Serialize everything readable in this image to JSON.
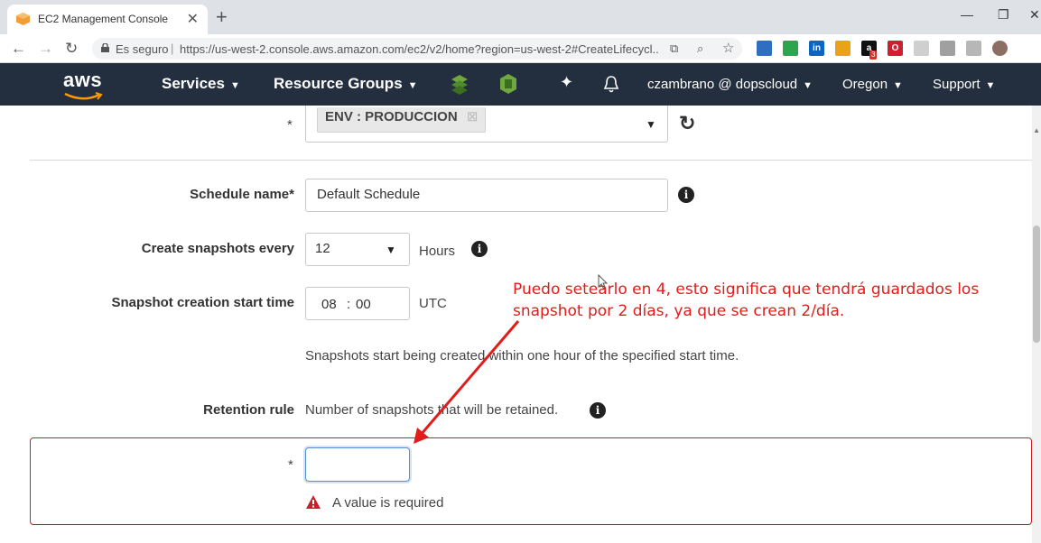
{
  "browser": {
    "tab_title": "EC2 Management Console",
    "tab_close": "✕",
    "new_tab": "+",
    "window_controls": [
      "—",
      "❐",
      "✕"
    ],
    "secure_label": "Es seguro",
    "separator": "|",
    "url": "https://us-west-2.console.aws.amazon.com/ec2/v2/home?region=us-west-2#CreateLifecycl...",
    "extensions": [
      {
        "icon": "ext-blue-square-icon",
        "color": "#2e6fc0",
        "text": ""
      },
      {
        "icon": "ext-green-download-icon",
        "color": "#2ea44f",
        "text": ""
      },
      {
        "icon": "linkedin-icon",
        "color": "#0a66c2",
        "text": "in"
      },
      {
        "icon": "ext-orange-warning-icon",
        "color": "#e8a317",
        "text": ""
      },
      {
        "icon": "ext-amazon-icon",
        "color": "#111111",
        "text": "a"
      },
      {
        "icon": "opera-icon",
        "color": "#cc1f2f",
        "text": "O"
      },
      {
        "icon": "ext-gray-doc-icon",
        "color": "#cfcfcf",
        "text": ""
      },
      {
        "icon": "ext-cloud-icon",
        "color": "#a0a0a0",
        "text": ""
      },
      {
        "icon": "ext-circle-icon",
        "color": "#b7b7b7",
        "text": ""
      },
      {
        "icon": "profile-avatar-icon",
        "color": "#8d6e63",
        "text": ""
      }
    ],
    "ext_badge": "3"
  },
  "aws_header": {
    "logo": "aws",
    "services": "Services",
    "resource_groups": "Resource Groups",
    "account": "czambrano @ dopscloud",
    "region": "Oregon",
    "support": "Support"
  },
  "form": {
    "tag_chip": "ENV : PRODUCCION",
    "asterisk": "*",
    "schedule_name_label": "Schedule name*",
    "schedule_name_value": "Default Schedule",
    "create_every_label": "Create snapshots every",
    "create_every_value": "12",
    "hours_label": "Hours",
    "start_time_label": "Snapshot creation start time",
    "start_hour": "08",
    "time_colon": ":",
    "start_minute": "00",
    "utc_label": "UTC",
    "start_time_help": "Snapshots start being created within one hour of the specified start time.",
    "retention_label": "Retention rule",
    "retention_help": "Number of snapshots that will be retained.",
    "retention_value": "",
    "error_message": "A value is required",
    "info_glyph": "i"
  },
  "annotation": {
    "text": "Puedo setearlo en 4, esto significa que tendrá guardados los snapshot por 2 días, ya que se crean 2/día.",
    "color": "#e21b1b"
  },
  "colors": {
    "aws_nav": "#232f3e",
    "error_border": "#c7202a",
    "focus_border": "#5b8fd0"
  }
}
